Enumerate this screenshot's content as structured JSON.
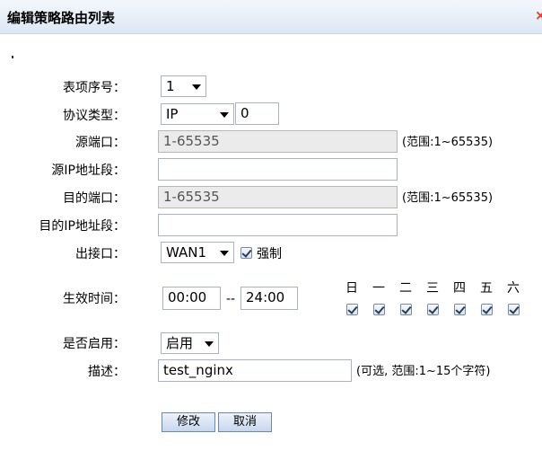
{
  "window": {
    "title": "编辑策略路由列表",
    "close_glyph": "×"
  },
  "form": {
    "entry_no": {
      "label": "表项序号：",
      "value": "1"
    },
    "protocol": {
      "label": "协议类型：",
      "value": "IP",
      "port": "0"
    },
    "src_port": {
      "label": "源端口：",
      "placeholder": "1-65535",
      "hint": "(范围:1~65535)"
    },
    "src_ip": {
      "label": "源IP地址段：",
      "value": ""
    },
    "dst_port": {
      "label": "目的端口：",
      "placeholder": "1-65535",
      "hint": "(范围:1~65535)"
    },
    "dst_ip": {
      "label": "目的IP地址段：",
      "value": ""
    },
    "out_iface": {
      "label": "出接口：",
      "value": "WAN1",
      "force_label": "强制",
      "force_checked": true
    },
    "time": {
      "label": "生效时间：",
      "start": "00:00",
      "sep": "--",
      "end": "24:00",
      "days": [
        "日",
        "一",
        "二",
        "三",
        "四",
        "五",
        "六"
      ],
      "days_checked": [
        true,
        true,
        true,
        true,
        true,
        true,
        true
      ]
    },
    "enabled": {
      "label": "是否启用：",
      "value": "启用"
    },
    "desc": {
      "label": "描述：",
      "value": "test_nginx",
      "hint": "(可选, 范围:1~15个字符)"
    }
  },
  "buttons": {
    "modify": "修改",
    "cancel": "取消"
  }
}
